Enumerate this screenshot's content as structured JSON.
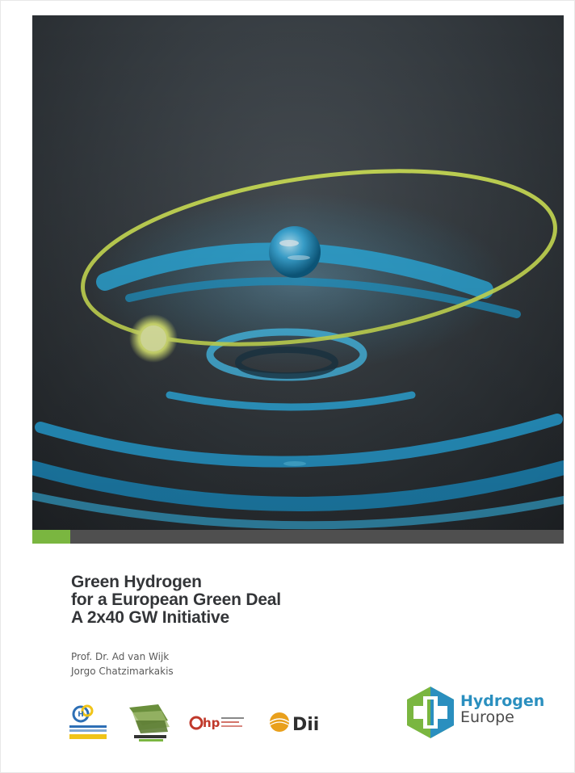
{
  "title": {
    "lines": [
      "Green Hydrogen",
      "for a European Green Deal",
      "A 2x40 GW Initiative"
    ]
  },
  "authors": [
    "Prof. Dr. Ad van Wijk",
    "Jorgo Chatzimarkakis"
  ],
  "brand": {
    "name_line1": "Hydrogen",
    "name_line2": "Europe"
  },
  "partners": [
    {
      "name": "Hydrogen Ukraine logo",
      "icon": "hydrogen-ukraine-logo"
    },
    {
      "name": "MENA logo",
      "icon": "mena-logo"
    },
    {
      "name": "ahp",
      "caption": "African Hydrogen Partnership",
      "icon": "ahp-logo"
    },
    {
      "name": "Dii",
      "icon": "dii-logo"
    }
  ],
  "colors": {
    "accent_green": "#7ab640",
    "bar_gray": "#4f4f4f",
    "title_text": "#333538",
    "brand_blue": "#2a8fbf",
    "brand_green": "#7ab640",
    "water_blue": "#2fb4e8",
    "orbit_yellow": "#d9ee5a"
  }
}
